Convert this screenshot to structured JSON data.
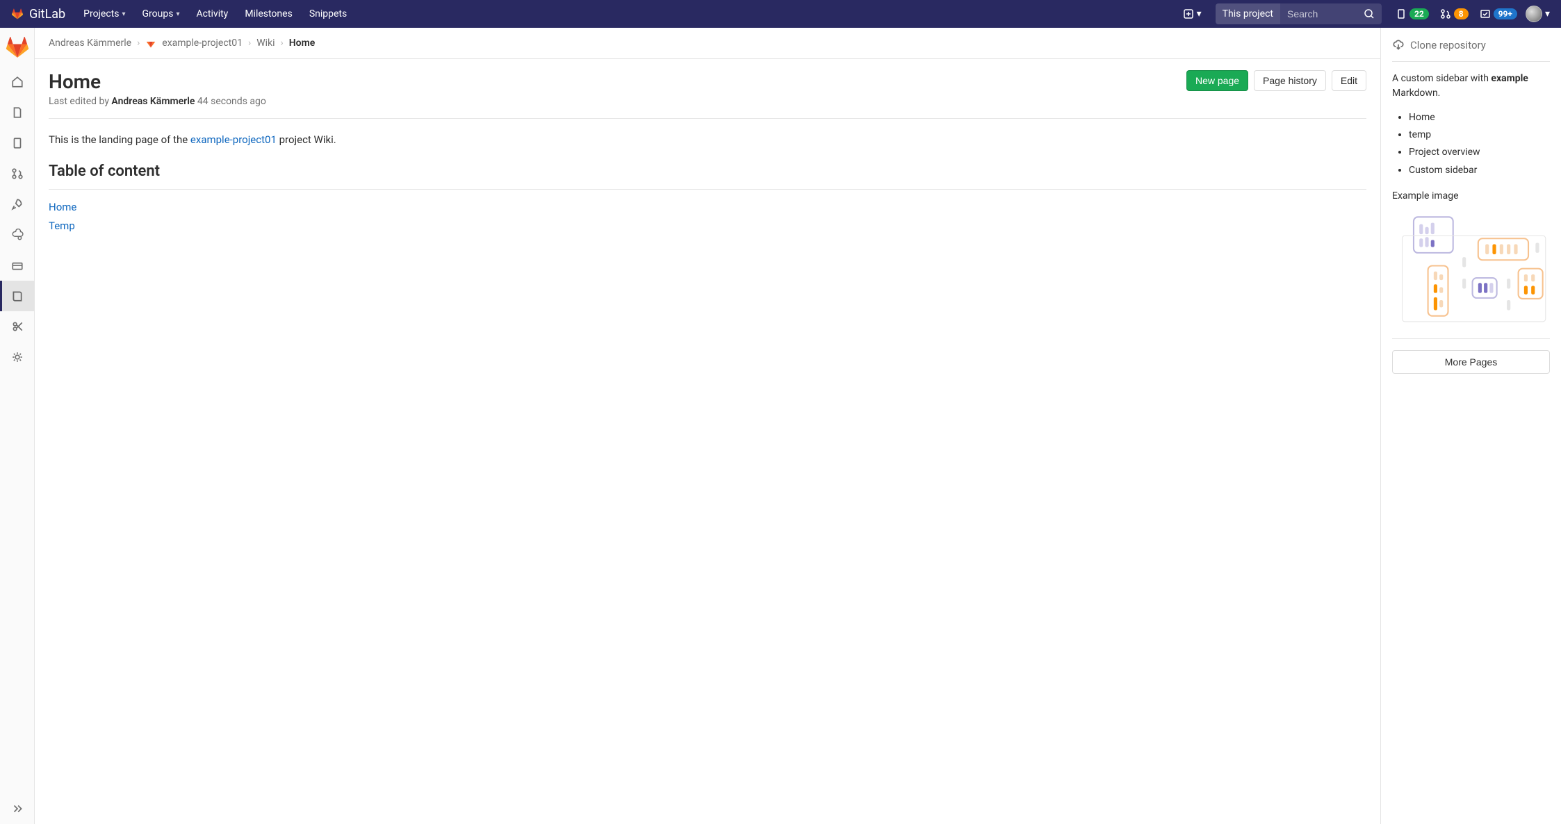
{
  "brand": "GitLab",
  "nav": {
    "projects": "Projects",
    "groups": "Groups",
    "activity": "Activity",
    "milestones": "Milestones",
    "snippets": "Snippets"
  },
  "search": {
    "scope": "This project",
    "placeholder": "Search"
  },
  "counters": {
    "issues": "22",
    "mrs": "8",
    "todos": "99+"
  },
  "crumbs": {
    "user": "Andreas Kämmerle",
    "project": "example-project01",
    "section": "Wiki",
    "page": "Home"
  },
  "page": {
    "title": "Home",
    "last_edit_prefix": "Last edited by ",
    "last_edit_author": "Andreas Kämmerle",
    "last_edit_time": "44 seconds ago",
    "new_page": "New page",
    "history": "Page history",
    "edit": "Edit"
  },
  "wiki": {
    "intro_a": "This is the landing page of the ",
    "intro_link": "example-project01",
    "intro_b": " project Wiki.",
    "toc_title": "Table of content",
    "toc": [
      "Home",
      "Temp"
    ]
  },
  "rsb": {
    "clone": "Clone repository",
    "desc_a": "A custom sidebar with ",
    "desc_b": "example",
    "desc_c": " Markdown.",
    "items": [
      "Home",
      "temp",
      "Project overview",
      "Custom sidebar"
    ],
    "img_label": "Example image",
    "more": "More Pages"
  }
}
